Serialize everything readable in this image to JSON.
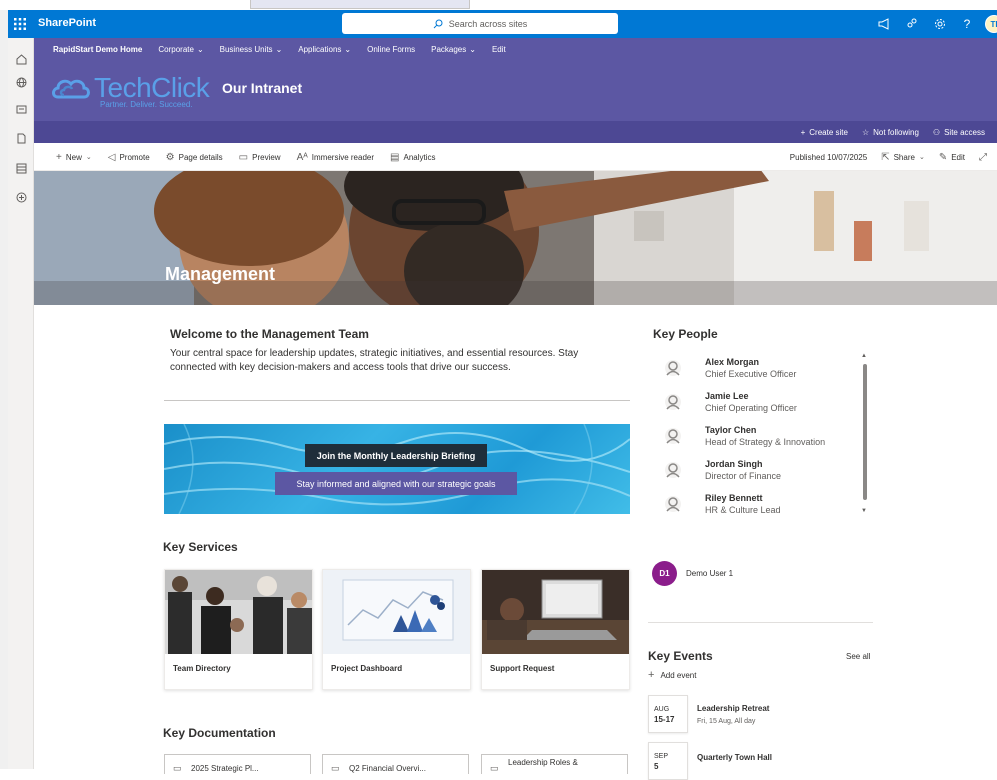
{
  "suite": {
    "brand": "SharePoint",
    "search_placeholder": "Search across sites"
  },
  "hub_nav": {
    "home": "RapidStart Demo Home",
    "items": [
      "Corporate",
      "Business Units",
      "Applications",
      "Online Forms",
      "Packages",
      "Edit"
    ]
  },
  "site": {
    "logo_text": "TechClick",
    "logo_tagline": "Partner. Deliver. Succeed.",
    "title": "Our Intranet",
    "actions": [
      "Create site",
      "Not following",
      "Site access"
    ]
  },
  "command_bar": {
    "left": [
      "New",
      "Promote",
      "Page details",
      "Preview",
      "Immersive reader",
      "Analytics"
    ],
    "published": "Published 10/07/2025",
    "share": "Share",
    "edit": "Edit"
  },
  "hero": {
    "title": "Management"
  },
  "welcome": {
    "title": "Welcome to the Management Team",
    "text": "Your central space for leadership updates, strategic initiatives, and essential resources. Stay connected with key decision-makers and access tools that drive our success."
  },
  "banner": {
    "title": "Join the Monthly Leadership Briefing",
    "subtitle": "Stay informed and aligned with our strategic goals"
  },
  "key_services": {
    "title": "Key Services",
    "cards": [
      "Team Directory",
      "Project Dashboard",
      "Support Request"
    ]
  },
  "key_documentation": {
    "title": "Key Documentation",
    "docs": [
      "2025 Strategic Pl...",
      "Q2 Financial Overvi...",
      "Leadership Roles &"
    ]
  },
  "key_people": {
    "title": "Key People",
    "people": [
      {
        "name": "Alex Morgan",
        "title": "Chief Executive Officer"
      },
      {
        "name": "Jamie Lee",
        "title": "Chief Operating Officer"
      },
      {
        "name": "Taylor Chen",
        "title": "Head of Strategy & Innovation"
      },
      {
        "name": "Jordan Singh",
        "title": "Director of Finance"
      },
      {
        "name": "Riley Bennett",
        "title": "HR & Culture Lead"
      }
    ]
  },
  "user": {
    "initials": "D1",
    "name": "Demo User 1"
  },
  "key_events": {
    "title": "Key Events",
    "see_all": "See all",
    "add_event": "Add event",
    "events": [
      {
        "month": "AUG",
        "day": "15-17",
        "title": "Leadership Retreat",
        "sub": "Fri, 15 Aug, All day"
      },
      {
        "month": "SEP",
        "day": "5",
        "title": "Quarterly Town Hall",
        "sub": ""
      }
    ]
  },
  "colors": {
    "suite_bar": "#0078d4",
    "site_header": "#5c57a3",
    "accent_purple": "#5c57a3",
    "user_avatar": "#8b1d8b"
  }
}
